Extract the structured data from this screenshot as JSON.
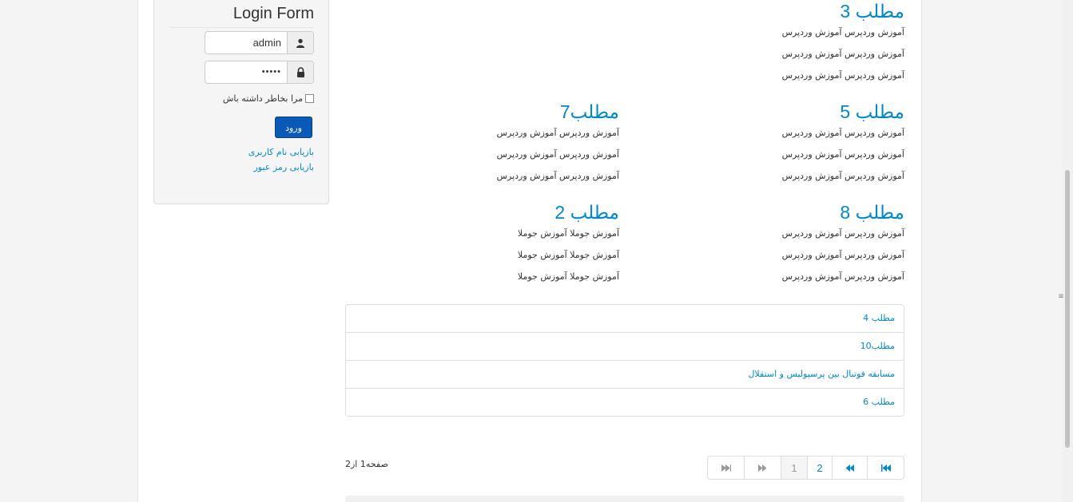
{
  "login": {
    "title": "Login Form",
    "username_value": "admin",
    "password_value": "•••••",
    "remember_label": "مرا بخاطر داشته باش",
    "submit_label": "ورود",
    "forgot_username": "بازیابی نام کاربری",
    "forgot_password": "بازیابی رمز عبور"
  },
  "articles": {
    "a3": {
      "title": "مطلب 3",
      "lines": [
        "آموزش وردپرس آموزش وردپرس",
        "آموزش وردپرس آموزش وردپرس",
        "آموزش وردپرس آموزش وردپرس"
      ]
    },
    "a5": {
      "title": "مطلب 5",
      "lines": [
        "آموزش وردپرس آموزش وردپرس",
        "آموزش وردپرس آموزش وردپرس",
        "آموزش وردپرس آموزش وردپرس"
      ]
    },
    "a7": {
      "title": "مطلب7",
      "lines": [
        "آموزش وردپرس آموزش وردپرس",
        "آموزش وردپرس آموزش وردپرس",
        "آموزش وردپرس آموزش وردپرس"
      ]
    },
    "a8": {
      "title": "مطلب 8",
      "lines": [
        "آموزش وردپرس آموزش وردپرس",
        "آموزش وردپرس آموزش وردپرس",
        "آموزش وردپرس آموزش وردپرس"
      ]
    },
    "a2": {
      "title": "مطلب 2",
      "lines": [
        "آموزش جوملا آموزش جوملا",
        "آموزش جوملا آموزش جوملا",
        "آموزش جوملا آموزش جوملا"
      ]
    }
  },
  "links": [
    "مطلب 4",
    "مطلب10",
    "مسابقه فوتبال بین پرسپولیس و استقلال",
    "مطلب 6"
  ],
  "pagination": {
    "page_text": "صفحه1 از2",
    "first_icon": "first-page-icon",
    "prev_icon": "previous-page-icon",
    "pages": [
      "2",
      "1"
    ],
    "next_icon": "next-page-icon",
    "last_icon": "last-page-icon"
  },
  "icons": {
    "user": "user-icon",
    "lock": "lock-icon"
  },
  "colors": {
    "link": "#0088cc",
    "button": "#0959b9"
  }
}
